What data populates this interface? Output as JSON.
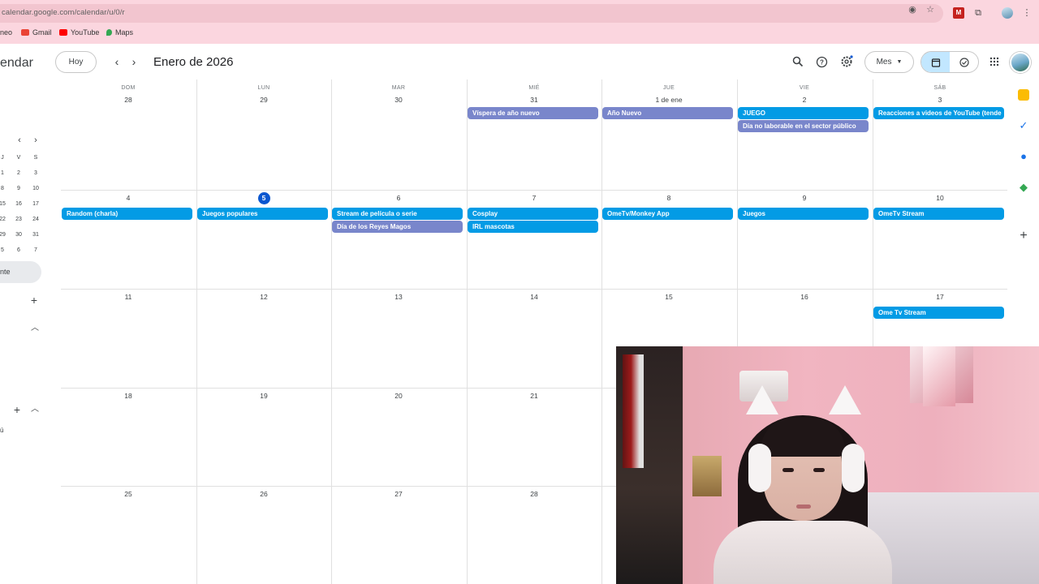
{
  "browser": {
    "url": "calendar.google.com/calendar/u/0/r",
    "bookmarks": [
      {
        "label": "neo"
      },
      {
        "label": "Gmail",
        "color": "#ea4335"
      },
      {
        "label": "YouTube",
        "color": "#ff0000"
      },
      {
        "label": "Maps",
        "color": "#34a853"
      }
    ]
  },
  "header": {
    "app_title": "endar",
    "today_button": "Hoy",
    "month_title": "Enero de 2026",
    "view_select": "Mes"
  },
  "sidebar": {
    "mini_calendar": {
      "weekday_headers": [
        "J",
        "V",
        "S"
      ],
      "rows": [
        [
          "1",
          "2",
          "3"
        ],
        [
          "8",
          "9",
          "10"
        ],
        [
          "15",
          "16",
          "17"
        ],
        [
          "22",
          "23",
          "24"
        ],
        [
          "29",
          "30",
          "31"
        ],
        [
          "5",
          "6",
          "7"
        ]
      ]
    },
    "selected_item": "nte",
    "footer_text": "ú"
  },
  "calendar": {
    "weekdays": [
      "DOM",
      "LUN",
      "MAR",
      "MIÉ",
      "JUE",
      "VIE",
      "SÁB"
    ],
    "weeks": [
      {
        "days": [
          "28",
          "29",
          "30",
          "31",
          "1 de ene",
          "2",
          "3"
        ],
        "events": [
          {
            "day": 3,
            "row": 0,
            "title": "Víspera de año nuevo",
            "color": "#7986cb"
          },
          {
            "day": 4,
            "row": 0,
            "title": "Año Nuevo",
            "color": "#7986cb"
          },
          {
            "day": 5,
            "row": 0,
            "title": "JUEGO",
            "color": "#039be5"
          },
          {
            "day": 5,
            "row": 1,
            "title": "Día no laborable en el sector público",
            "color": "#7986cb"
          },
          {
            "day": 6,
            "row": 0,
            "title": "Reacciones a videos de YouTube (tende",
            "color": "#039be5"
          }
        ]
      },
      {
        "days": [
          "4",
          "5",
          "6",
          "7",
          "8",
          "9",
          "10"
        ],
        "today_index": 1,
        "events": [
          {
            "day": 0,
            "row": 0,
            "title": "Random (charla)",
            "color": "#039be5"
          },
          {
            "day": 1,
            "row": 0,
            "title": "Juegos populares",
            "color": "#039be5"
          },
          {
            "day": 2,
            "row": 0,
            "title": "Stream de película o serie",
            "color": "#039be5"
          },
          {
            "day": 2,
            "row": 1,
            "title": "Día de los Reyes Magos",
            "color": "#7986cb"
          },
          {
            "day": 3,
            "row": 0,
            "title": "Cosplay",
            "color": "#039be5"
          },
          {
            "day": 3,
            "row": 1,
            "title": "IRL mascotas",
            "color": "#039be5"
          },
          {
            "day": 4,
            "row": 0,
            "title": "OmeTv/Monkey App",
            "color": "#039be5"
          },
          {
            "day": 5,
            "row": 0,
            "title": "Juegos",
            "color": "#039be5"
          },
          {
            "day": 6,
            "row": 0,
            "title": "OmeTv Stream",
            "color": "#039be5"
          }
        ]
      },
      {
        "days": [
          "11",
          "12",
          "13",
          "14",
          "15",
          "16",
          "17"
        ],
        "events": [
          {
            "day": 6,
            "row": 0,
            "title": "Ome Tv Stream",
            "color": "#039be5"
          }
        ]
      },
      {
        "days": [
          "18",
          "19",
          "20",
          "21",
          "",
          "",
          ""
        ],
        "events": []
      },
      {
        "days": [
          "25",
          "26",
          "27",
          "28",
          "",
          "",
          ""
        ],
        "events": []
      }
    ]
  },
  "colors": {
    "today_blue": "#0b57d0",
    "event_blue": "#039be5",
    "event_purple": "#7986cb",
    "browser_pink": "#fbd6df"
  }
}
